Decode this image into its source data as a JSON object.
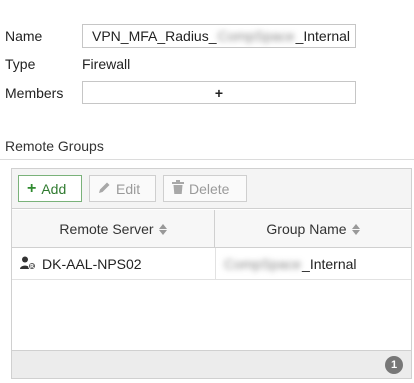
{
  "form": {
    "name_label": "Name",
    "name_prefix": "VPN_MFA_Radius_",
    "name_redacted": "CompSpace",
    "name_suffix": "_Internal",
    "type_label": "Type",
    "type_value": "Firewall",
    "members_label": "Members",
    "members_add": "+"
  },
  "remote_groups": {
    "title": "Remote Groups",
    "toolbar": {
      "add_label": "Add",
      "edit_label": "Edit",
      "delete_label": "Delete"
    },
    "columns": [
      "Remote Server",
      "Group Name"
    ],
    "rows": [
      {
        "server": "DK-AAL-NPS02",
        "group_redacted": "CompSpace",
        "group_suffix": "_Internal"
      }
    ],
    "count": "1"
  },
  "icons": {
    "add": "plus-icon",
    "edit": "pencil-icon",
    "delete": "trash-icon",
    "server": "user-server-icon",
    "sort": "sort-icon"
  },
  "colors": {
    "add_accent": "#2f8a2f",
    "disabled_text": "#9a9a9a",
    "badge": "#777777"
  }
}
